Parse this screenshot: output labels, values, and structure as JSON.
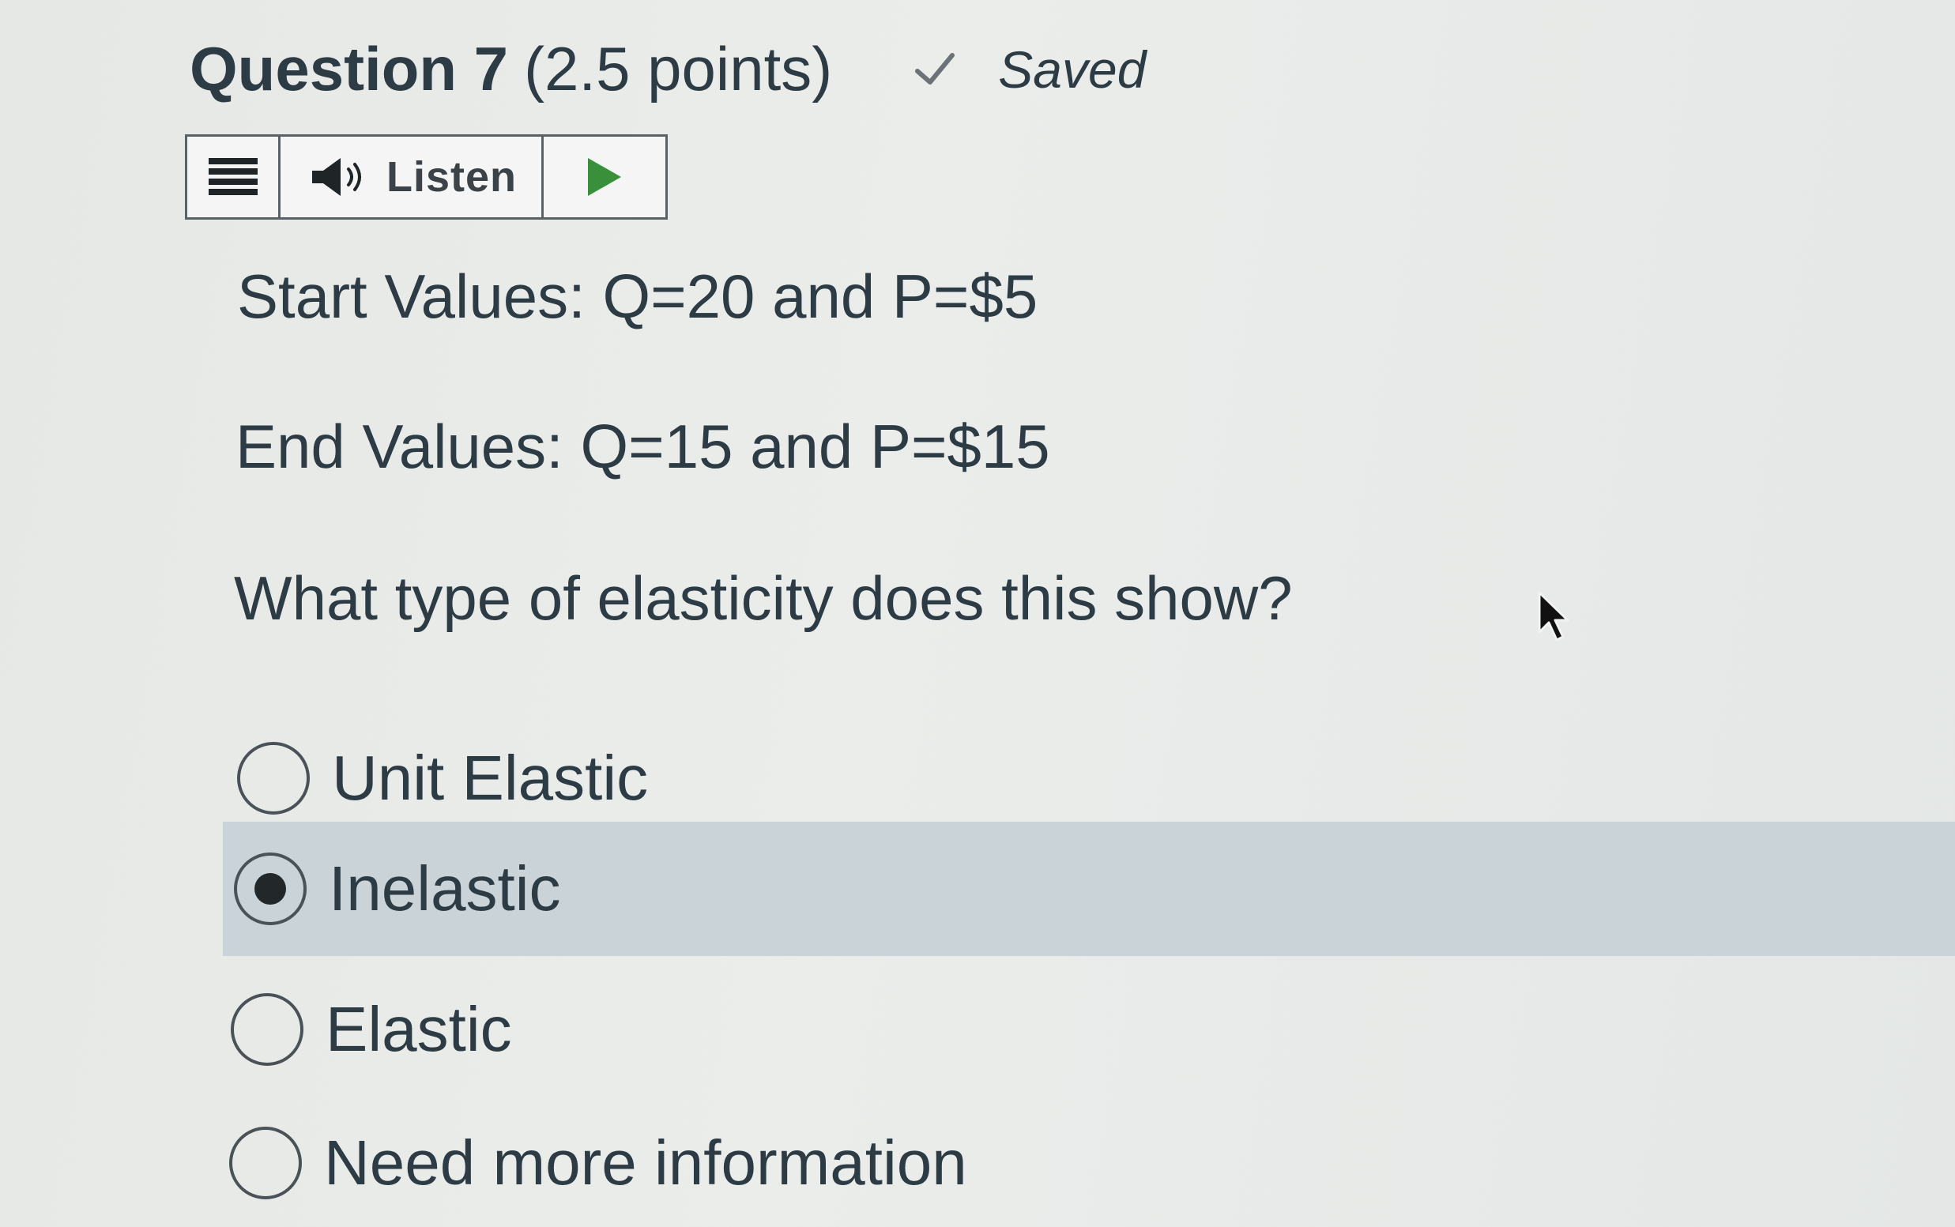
{
  "question": {
    "title": "Question 7",
    "points": "(2.5 points)",
    "status": "Saved",
    "status_icon": "checkmark-icon"
  },
  "listen_toolbar": {
    "menu_icon": "hamburger-menu-icon",
    "speaker_icon": "speaker-icon",
    "listen_label": "Listen",
    "play_icon": "play-icon",
    "accent_color": "#3a8f3a"
  },
  "content": {
    "start_values": "Start Values: Q=20 and P=$5",
    "end_values": "End Values: Q=15 and P=$15",
    "prompt": "What type of elasticity does this show?"
  },
  "answers": [
    {
      "label": "Unit Elastic",
      "selected": false
    },
    {
      "label": "Inelastic",
      "selected": true
    },
    {
      "label": "Elastic",
      "selected": false
    },
    {
      "label": "Need more information",
      "selected": false
    }
  ],
  "colors": {
    "text": "#2d3b45",
    "selected_row": "#c9d3d8",
    "background": "#e9ebe9"
  }
}
